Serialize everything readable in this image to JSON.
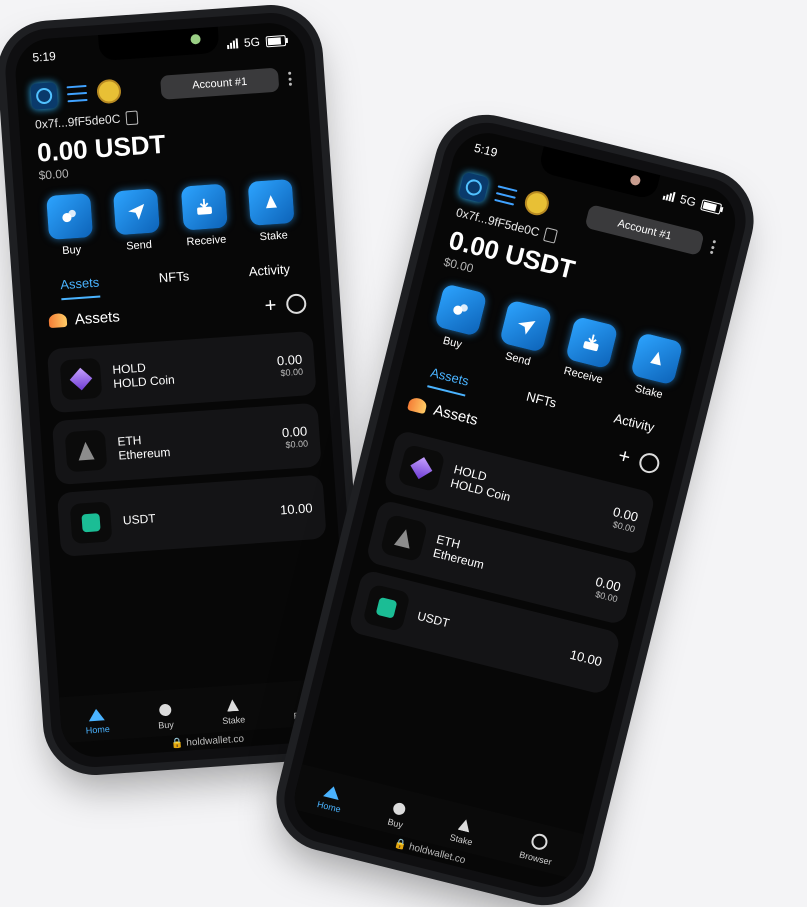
{
  "status": {
    "time": "5:19",
    "network": "5G"
  },
  "account": {
    "label": "Account #1"
  },
  "wallet": {
    "address": "0x7f...9fF5de0C",
    "balance": "0.00 USDT",
    "fiat": "$0.00"
  },
  "actions": [
    {
      "label": "Buy"
    },
    {
      "label": "Send"
    },
    {
      "label": "Receive"
    },
    {
      "label": "Stake"
    }
  ],
  "tabs": [
    {
      "label": "Assets"
    },
    {
      "label": "NFTs"
    },
    {
      "label": "Activity"
    }
  ],
  "assets_section": {
    "title": "Assets"
  },
  "assets": [
    {
      "symbol": "HOLD",
      "name": "HOLD Coin",
      "amount": "0.00",
      "usd": "$0.00"
    },
    {
      "symbol": "ETH",
      "name": "Ethereum",
      "amount": "0.00",
      "usd": "$0.00"
    },
    {
      "symbol": "USDT",
      "name": "",
      "amount": "10.00",
      "usd": ""
    }
  ],
  "bottom_nav": [
    {
      "label": "Home"
    },
    {
      "label": "Buy"
    },
    {
      "label": "Stake"
    },
    {
      "label": "Browser"
    }
  ],
  "url": "holdwallet.co",
  "colors": {
    "accent": "#4ab3ff",
    "background": "#070707"
  }
}
